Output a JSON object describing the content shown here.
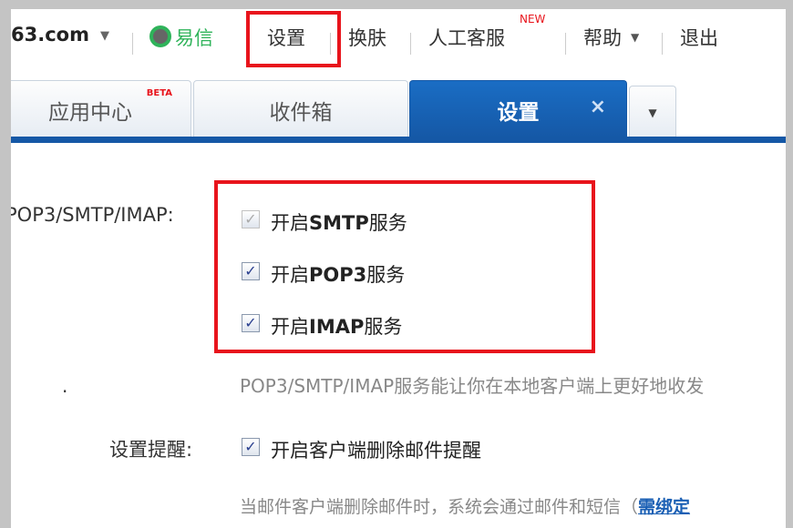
{
  "topbar": {
    "domain": "63.com",
    "yixin": "易信",
    "settings": "设置",
    "skin": "换肤",
    "service": "人工客服",
    "new_badge": "NEW",
    "help": "帮助",
    "logout": "退出"
  },
  "tabs": [
    {
      "label": "应用中心",
      "badge": "BETA"
    },
    {
      "label": "收件箱"
    },
    {
      "label": "设置",
      "close": "×",
      "active": true
    }
  ],
  "colors": {
    "accent": "#1558a6",
    "highlight": "#e8141c",
    "yixin_green": "#2fb35a"
  },
  "form": {
    "service_label": "POP3/SMTP/IMAP:",
    "options": [
      {
        "prefix": "开启",
        "bold": "SMTP",
        "suffix": "服务",
        "checked": true,
        "disabled": true
      },
      {
        "prefix": "开启",
        "bold": "POP3",
        "suffix": "服务",
        "checked": true,
        "disabled": false
      },
      {
        "prefix": "开启",
        "bold": "IMAP",
        "suffix": "服务",
        "checked": true,
        "disabled": false
      }
    ],
    "description": "POP3/SMTP/IMAP服务能让你在本地客户端上更好地收发",
    "reminder_label": "设置提醒:",
    "reminder_option": "开启客户端删除邮件提醒",
    "reminder_checked": true,
    "reminder_desc": "当邮件客户端删除邮件时，系统会通过邮件和短信（",
    "reminder_link": "需绑定"
  }
}
